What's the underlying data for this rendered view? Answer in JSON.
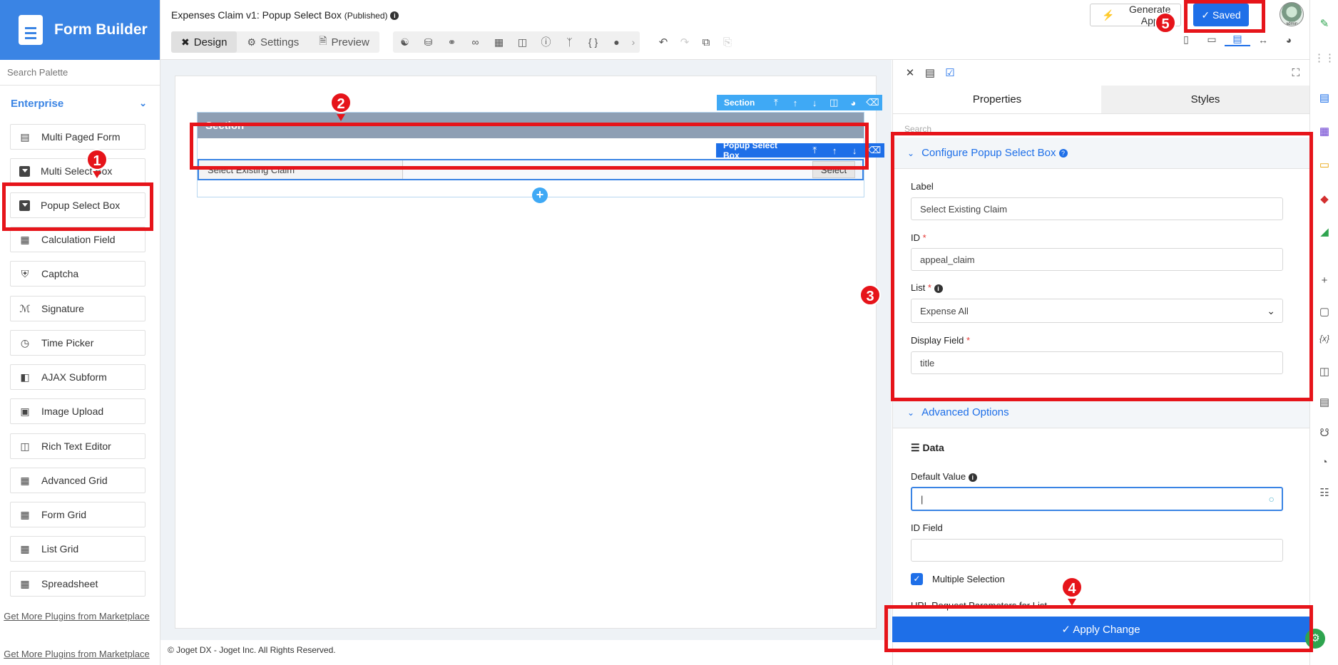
{
  "app": {
    "name": "Form Builder"
  },
  "palette": {
    "search_placeholder": "Search Palette",
    "category": "Enterprise",
    "items": [
      {
        "label": "Multi Paged Form",
        "icon": "multi-page-icon"
      },
      {
        "label": "Multi Select Box",
        "icon": "dropdown-icon"
      },
      {
        "label": "Popup Select Box",
        "icon": "dropdown-icon"
      },
      {
        "label": "Calculation Field",
        "icon": "calculator-icon"
      },
      {
        "label": "Captcha",
        "icon": "shield-icon"
      },
      {
        "label": "Signature",
        "icon": "signature-icon"
      },
      {
        "label": "Time Picker",
        "icon": "clock-icon"
      },
      {
        "label": "AJAX Subform",
        "icon": "subform-icon"
      },
      {
        "label": "Image Upload",
        "icon": "image-icon"
      },
      {
        "label": "Rich Text Editor",
        "icon": "rich-text-icon"
      },
      {
        "label": "Advanced Grid",
        "icon": "grid-icon"
      },
      {
        "label": "Form Grid",
        "icon": "grid-icon"
      },
      {
        "label": "List Grid",
        "icon": "grid-icon"
      },
      {
        "label": "Spreadsheet",
        "icon": "grid-icon"
      }
    ],
    "more_plugins_1": "Get More Plugins from Marketplace",
    "more_plugins_2": "Get More Plugins from Marketplace"
  },
  "header": {
    "form_title": "Expenses Claim v1: Popup Select Box",
    "status": "(Published)",
    "tabs": [
      "Design",
      "Settings",
      "Preview"
    ],
    "generate_label": "Generate App",
    "saved_label": "Saved",
    "avatar_text": "admin"
  },
  "canvas": {
    "section_toolbar_label": "Section",
    "section_title": "Section",
    "element_toolbar_label": "Popup Select Box",
    "field_label": "Select Existing Claim",
    "select_button": "Select"
  },
  "footer": {
    "copyright": "© Joget DX - Joget Inc. All Rights Reserved."
  },
  "properties": {
    "tabs": [
      "Properties",
      "Styles"
    ],
    "search_placeholder": "Search",
    "config_section": "Configure Popup Select Box",
    "label_label": "Label",
    "label_value": "Select Existing Claim",
    "id_label": "ID",
    "id_value": "appeal_claim",
    "list_label": "List",
    "list_value": "Expense All",
    "display_field_label": "Display Field",
    "display_field_value": "title",
    "advanced_section": "Advanced Options",
    "data_label": "Data",
    "default_value_label": "Default Value",
    "default_value": "",
    "id_field_label": "ID Field",
    "id_field_value": "",
    "multiple_selection_label": "Multiple Selection",
    "multiple_selection_checked": true,
    "url_params_label": "URL Request Parameters for List",
    "apply_label": "Apply Change"
  },
  "annotations": [
    "1",
    "2",
    "3",
    "4",
    "5"
  ],
  "colors": {
    "brand": "#3a84e4",
    "primary": "#1e6fe8",
    "annotation": "#e6141a",
    "section_header": "#8e9fb4"
  }
}
